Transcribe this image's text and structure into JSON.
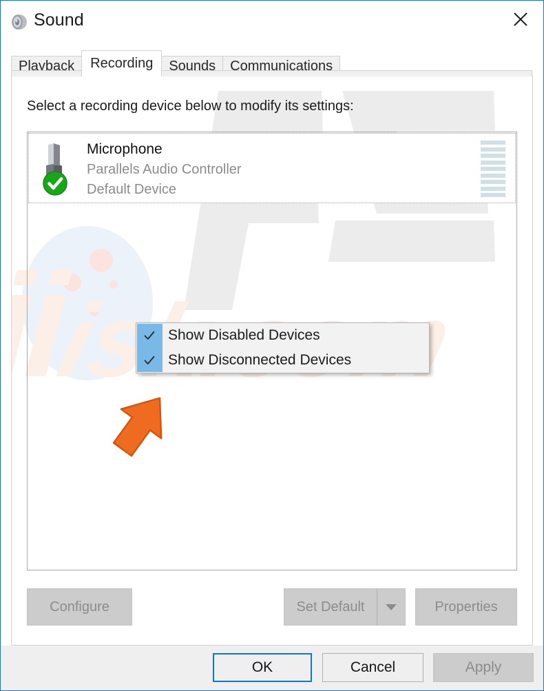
{
  "window": {
    "title": "Sound",
    "icon": "speaker-icon",
    "close_label": "✕",
    "border_color": "#1d74b8"
  },
  "tabs": [
    {
      "label": "Playback",
      "active": false
    },
    {
      "label": "Recording",
      "active": true
    },
    {
      "label": "Sounds",
      "active": false
    },
    {
      "label": "Communications",
      "active": false
    }
  ],
  "page": {
    "instruction": "Select a recording device below to modify its settings:"
  },
  "device_list": {
    "devices": [
      {
        "name": "Microphone",
        "description": "Parallels Audio Controller",
        "status": "Default Device",
        "icon": "microphone-icon",
        "badge": "default-device-check-badge",
        "badge_color": "#17a717",
        "meter_levels": 9,
        "meter_color": "#cfe0e6"
      }
    ]
  },
  "context_menu": {
    "items": [
      {
        "label": "Show Disabled Devices",
        "checked": true
      },
      {
        "label": "Show Disconnected Devices",
        "checked": true
      }
    ],
    "check_glyph": "✓",
    "gutter_color": "#78b9e7"
  },
  "annotation": {
    "arrow": "orange-pointer-arrow",
    "color": "#ee6b1f"
  },
  "watermark": {
    "logo_text": "PC",
    "domain_text": "risk.com",
    "logo_color": "#ececec",
    "domain_color": "#fcefe8"
  },
  "device_actions": {
    "configure": "Configure",
    "set_default": "Set Default",
    "set_default_dropdown": "▼",
    "properties": "Properties"
  },
  "footer": {
    "ok": "OK",
    "cancel": "Cancel",
    "apply": "Apply",
    "focus_color": "#0a7ac8"
  }
}
